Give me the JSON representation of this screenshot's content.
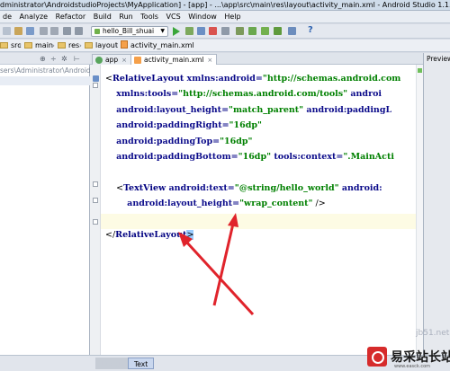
{
  "window": {
    "title": "dministrator\\AndroidstudioProjects\\MyApplication] - [app] - ...\\app\\src\\main\\res\\layout\\activity_main.xml - Android Studio 1.1.0"
  },
  "menu": [
    "de",
    "Analyze",
    "Refactor",
    "Build",
    "Run",
    "Tools",
    "VCS",
    "Window",
    "Help"
  ],
  "toolbar": {
    "run_config": "hello_Bill_shuai",
    "help_glyph": "?"
  },
  "breadcrumb": [
    "src",
    "main",
    "res",
    "layout",
    "activity_main.xml"
  ],
  "project_panel": {
    "path_text": "sers\\Administrator\\Androids"
  },
  "tabs": [
    {
      "label": "app",
      "active": false
    },
    {
      "label": "activity_main.xml",
      "active": true
    }
  ],
  "preview_label": "Preview",
  "code": {
    "line1": {
      "open": "<",
      "tag": "RelativeLayout",
      "attr": " xmlns:android=",
      "str": "\"http://schemas.android.com"
    },
    "line2": {
      "attr": "xmlns:tools=",
      "str": "\"http://schemas.android.com/tools\"",
      "attr2": " androi"
    },
    "line3": {
      "attr": "android:layout_height=",
      "str": "\"match_parent\"",
      "attr2": " android:paddingL"
    },
    "line4": {
      "attr": "android:paddingRight=",
      "str": "\"16dp\""
    },
    "line5": {
      "attr": "android:paddingTop=",
      "str": "\"16dp\""
    },
    "line6": {
      "attr": "android:paddingBottom=",
      "str": "\"16dp\"",
      "attr2": " tools:context=",
      "str2": "\".MainActi"
    },
    "line8": {
      "open": "<",
      "tag": "TextView",
      "attr": " android:text=",
      "str": "\"@string/hello_world\"",
      "attr2": " android:"
    },
    "line9": {
      "attr": "android:layout_height=",
      "str": "\"wrap_content\"",
      "close": " />"
    },
    "line11": {
      "open": "</",
      "tag": "RelativeLayout",
      "close": ">"
    }
  },
  "bottom_tabs": [
    "Design",
    "Text"
  ],
  "watermark": {
    "faint": "jb51.net",
    "brand": "易采站长站",
    "url": "www.easck.com"
  },
  "colors": {
    "annotation_arrow": "#e0232b",
    "string_literal": "#008000",
    "tag": "#000080",
    "current_line": "#fdfbe4"
  }
}
